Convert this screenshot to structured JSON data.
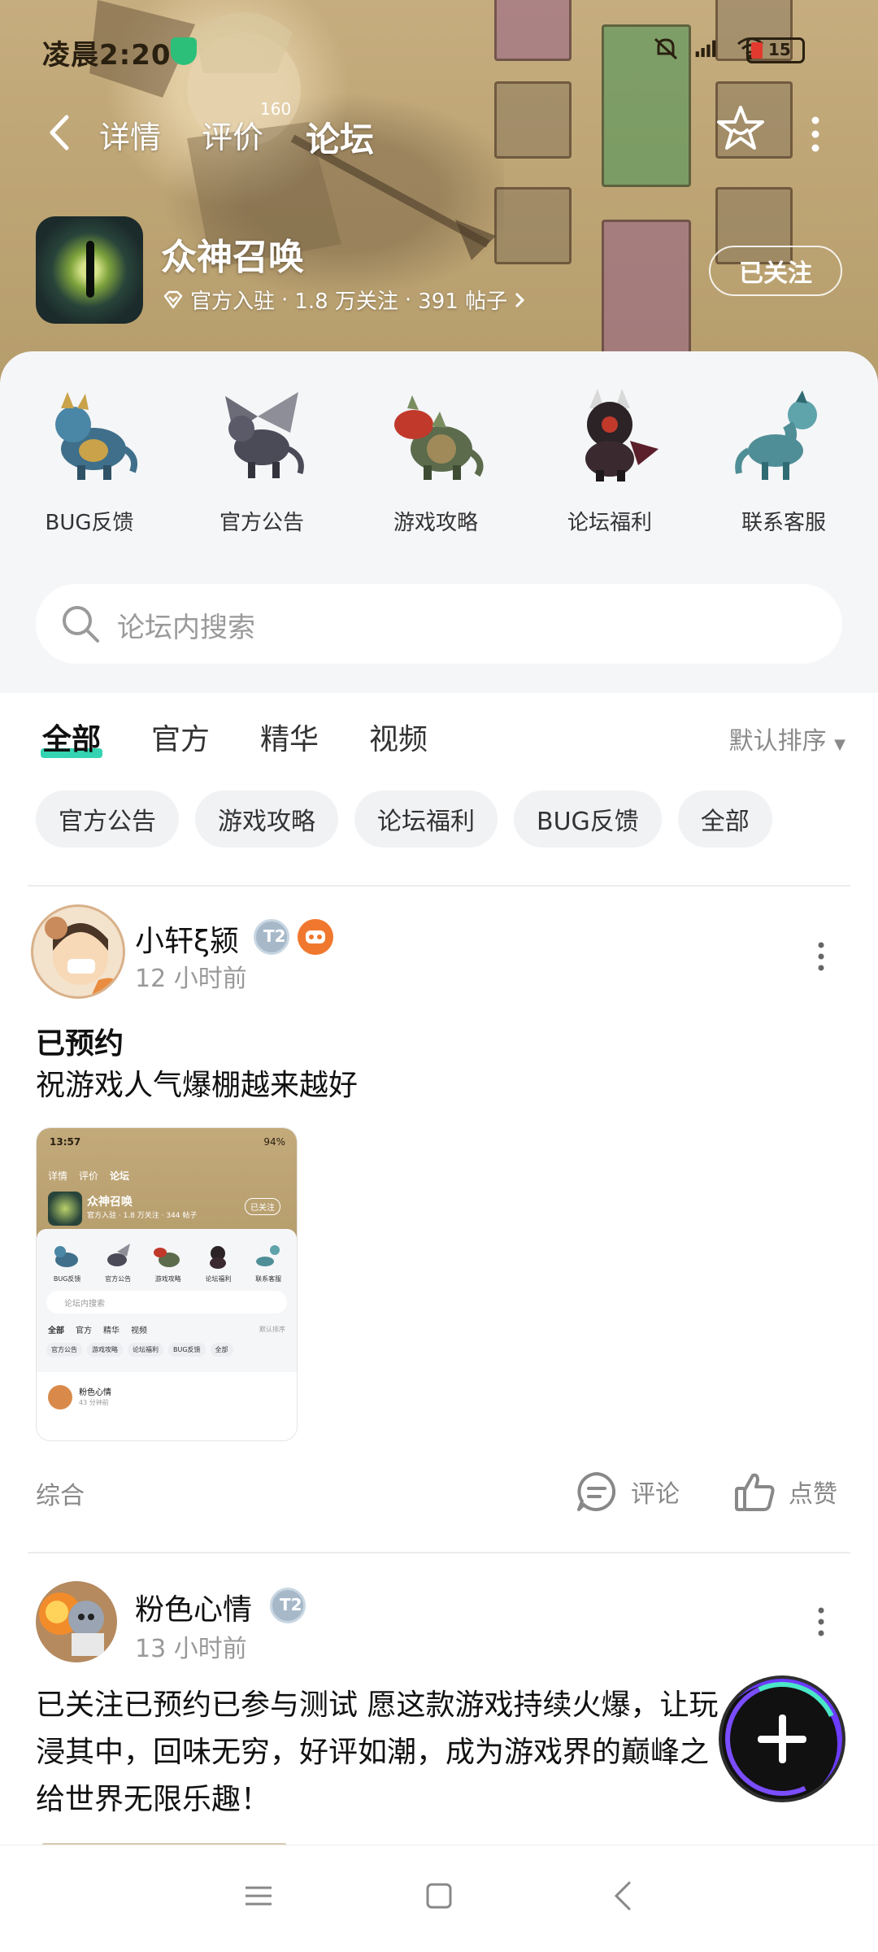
{
  "status": {
    "time": "凌晨2:20",
    "battery": "15"
  },
  "nav": {
    "back_label": "back",
    "tabs": [
      {
        "label": "详情"
      },
      {
        "label": "评价",
        "badge": "160"
      },
      {
        "label": "论坛"
      }
    ]
  },
  "app": {
    "name": "众神召唤",
    "official": "官方入驻",
    "followers": "1.8 万关注",
    "posts": "391 帖子",
    "follow_button": "已关注"
  },
  "categories": [
    {
      "label": "BUG反馈",
      "icon": "blue-dragon-icon"
    },
    {
      "label": "官方公告",
      "icon": "winged-dragon-icon"
    },
    {
      "label": "游戏攻略",
      "icon": "red-dragon-icon"
    },
    {
      "label": "论坛福利",
      "icon": "dark-dragon-icon"
    },
    {
      "label": "联系客服",
      "icon": "teal-dragon-icon"
    }
  ],
  "search": {
    "placeholder": "论坛内搜索"
  },
  "tabs": [
    {
      "label": "全部",
      "active": true
    },
    {
      "label": "官方"
    },
    {
      "label": "精华"
    },
    {
      "label": "视频"
    }
  ],
  "sort_label": "默认排序",
  "chips": [
    "官方公告",
    "游戏攻略",
    "论坛福利",
    "BUG反馈",
    "全部"
  ],
  "posts": [
    {
      "user": "小轩ξ颍",
      "time": "12 小时前",
      "title": "已预约",
      "body": "祝游戏人气爆棚越来越好",
      "category": "综合",
      "comment_label": "评论",
      "like_label": "点赞",
      "thumb": {
        "time": "13:57",
        "battery": "94%",
        "tabs": [
          "详情",
          "评价",
          "论坛"
        ],
        "app_name": "众神召唤",
        "app_meta": "官方入驻 · 1.8 万关注 · 344 帖子",
        "follow": "已关注",
        "cats": [
          "BUG反馈",
          "官方公告",
          "游戏攻略",
          "论坛福利",
          "联系客服"
        ],
        "search": "论坛内搜索",
        "tabs2": [
          "全部",
          "官方",
          "精华",
          "视频"
        ],
        "sort": "默认排序",
        "chips": [
          "官方公告",
          "游戏攻略",
          "论坛福利",
          "BUG反馈",
          "全部"
        ],
        "user": "粉色心情",
        "user_time": "43 分钟前"
      }
    },
    {
      "user": "粉色心情",
      "time": "13 小时前",
      "body_lines": [
        "已关注已预约已参与测试 愿这款游戏持续火爆，让玩",
        "浸其中，回味无穷，好评如潮，成为游戏界的巅峰之",
        "给世界无限乐趣！"
      ]
    }
  ],
  "colors": {
    "accent": "#34d4b2",
    "header_bg": "#bfa676",
    "panel_bg": "#f5f6f8"
  }
}
